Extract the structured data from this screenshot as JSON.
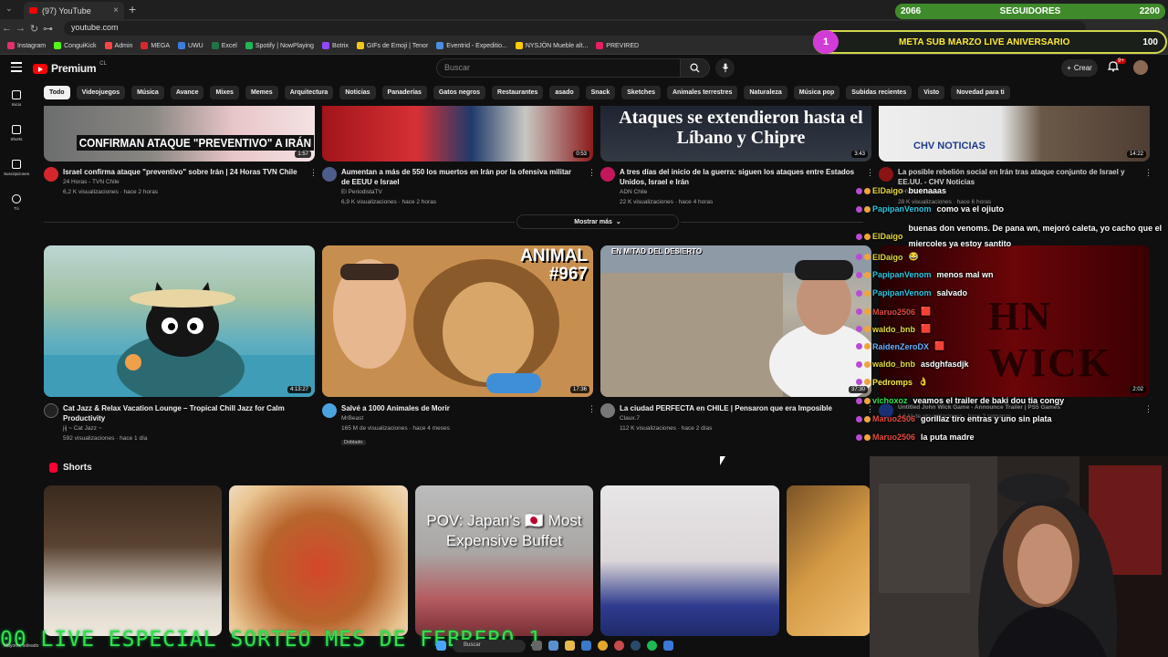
{
  "browser": {
    "tab_title": "(97) YouTube",
    "url": "youtube.com",
    "bookmarks": [
      "Instagram",
      "ConguiKick",
      "Admin",
      "MEGA",
      "UWU",
      "Excel",
      "Spotify | NowPlaying",
      "Botrix",
      "GIFs de Emoji | Tenor",
      "Eventrid - Expeditio...",
      "NYSJÖN Mueble alt...",
      "PREVIRED"
    ]
  },
  "youtube": {
    "logo_text": "Premium",
    "logo_country": "CL",
    "search_placeholder": "Buscar",
    "create_label": "Crear",
    "notif_count": "9+",
    "rail": [
      {
        "label": "Inicio",
        "icon": "home-icon"
      },
      {
        "label": "Shorts",
        "icon": "shorts-icon"
      },
      {
        "label": "Suscripciones",
        "icon": "subscriptions-icon"
      },
      {
        "label": "Tú",
        "icon": "you-icon"
      }
    ],
    "chips": [
      "Todo",
      "Videojuegos",
      "Música",
      "Avance",
      "Mixes",
      "Memes",
      "Arquitectura",
      "Noticias",
      "Panaderías",
      "Gatos negros",
      "Restaurantes",
      "asado",
      "Snack",
      "Sketches",
      "Animales terrestres",
      "Naturaleza",
      "Música pop",
      "Subidas recientes",
      "Visto",
      "Novedad para ti"
    ],
    "show_more": "Mostrar más",
    "shorts_title": "Shorts"
  },
  "videos_row1": [
    {
      "title": "Israel confirma ataque \"preventivo\" sobre Irán | 24 Horas TVN Chile",
      "channel": "24 Horas - TVN Chile",
      "stats": "6,2 K visualizaciones · hace 2 horas",
      "duration": "1:57",
      "caption": "CONFIRMAN ATAQUE \"PREVENTIVO\" A IRÁN"
    },
    {
      "title": "Aumentan a más de 550 los muertos en Irán por la ofensiva militar de EEUU e Israel",
      "channel": "El PeriodistaTV",
      "stats": "6,9 K visualizaciones · hace 2 horas",
      "duration": "0:53",
      "caption": ""
    },
    {
      "title": "A tres días del inicio de la guerra: siguen los ataques entre Estados Unidos, Israel e Irán",
      "channel": "ADN Chile",
      "stats": "22 K visualizaciones · hace 4 horas",
      "duration": "3:43",
      "caption": "Ataques se extendieron hasta el Líbano y Chipre"
    },
    {
      "title": "La posible rebelión social en Irán tras ataque conjunto de Israel y EE.UU. - CHV Noticias",
      "channel": "CHV Noticias",
      "stats": "28 K visualizaciones · hace 6 horas",
      "duration": "14:22",
      "caption": "CHV NOTICIAS"
    }
  ],
  "videos_row2": [
    {
      "title": "Cat Jazz & Relax Vacation Lounge – Tropical Chill Jazz for Calm Productivity",
      "channel": "jij ~ Cat Jazz ~",
      "stats": "592 visualizaciones · hace 1 día",
      "duration": "4:13:27",
      "extra": ""
    },
    {
      "title": "Salvé a 1000 Animales de Morir",
      "channel": "MrBeast",
      "stats": "165 M de visualizaciones · hace 4 meses",
      "duration": "17:36",
      "extra": "Doblado",
      "overlay": "ANIMAL #967"
    },
    {
      "title": "La ciudad PERFECTA en CHILE | Pensaron que era Imposible",
      "channel": "Claux.7",
      "stats": "112 K visualizaciones · hace 2 días",
      "duration": "37:30",
      "extra": "",
      "overlay": "EN MITAD DEL DESIERTO"
    },
    {
      "title": "Untitled John Wick Game - Announce Trailer | PS5 Games",
      "channel": "",
      "stats": "4,6 M de visualizaciones · hace 2 semanas",
      "duration": "2:02",
      "extra": "",
      "overlay": "HN WICK"
    }
  ],
  "shorts": [
    {
      "overlay": ""
    },
    {
      "overlay": ""
    },
    {
      "overlay": "POV: Japan's 🇯🇵 Most Expensive Buffet"
    },
    {
      "overlay": ""
    },
    {
      "overlay": ""
    }
  ],
  "stream_overlay": {
    "followers_start": "2066",
    "followers_label": "SEGUIDORES",
    "followers_goal": "2200",
    "meta_rank": "1",
    "meta_label": "META SUB MARZO LIVE ANIVERSARIO",
    "meta_value": "100",
    "ticker": "00 LIVE ESPECIAL SORTEO MES DE FEBRERO 1",
    "weather": "Mayorm. soleado"
  },
  "chat": [
    {
      "user": "ElDaigo",
      "text": "buenaaas",
      "color": "#e7d93d"
    },
    {
      "user": "PapipanVenom",
      "text": "como va el ojiuto",
      "color": "#2ec4e0"
    },
    {
      "user": "ElDaigo",
      "text": "buenas don venoms. De pana wn, mejoró caleta, yo cacho que el miercoles ya estoy santito",
      "color": "#e7d93d"
    },
    {
      "user": "ElDaigo",
      "text": "😂",
      "color": "#e7d93d"
    },
    {
      "user": "PapipanVenom",
      "text": "menos mal wn",
      "color": "#2ec4e0"
    },
    {
      "user": "PapipanVenom",
      "text": "salvado",
      "color": "#2ec4e0"
    },
    {
      "user": "Maruo2506",
      "text": "🟥",
      "color": "#e24b43"
    },
    {
      "user": "waldo_bnb",
      "text": "🟥",
      "color": "#e7d93d"
    },
    {
      "user": "RaidenZeroDX",
      "text": "🟥",
      "color": "#6ab0ff"
    },
    {
      "user": "waldo_bnb",
      "text": "asdghfasdjk",
      "color": "#e7d93d"
    },
    {
      "user": "Pedromps",
      "text": "👌",
      "color": "#ffe93c"
    },
    {
      "user": "vichoxoz",
      "text": "veamos el trailer de baki dou tia congy",
      "color": "#33e04a"
    },
    {
      "user": "Maruo2506",
      "text": "gorillaz tiro entras y uno sin plata",
      "color": "#e24b43"
    },
    {
      "user": "Maruo2506",
      "text": "la puta madre",
      "color": "#e24b43"
    }
  ]
}
